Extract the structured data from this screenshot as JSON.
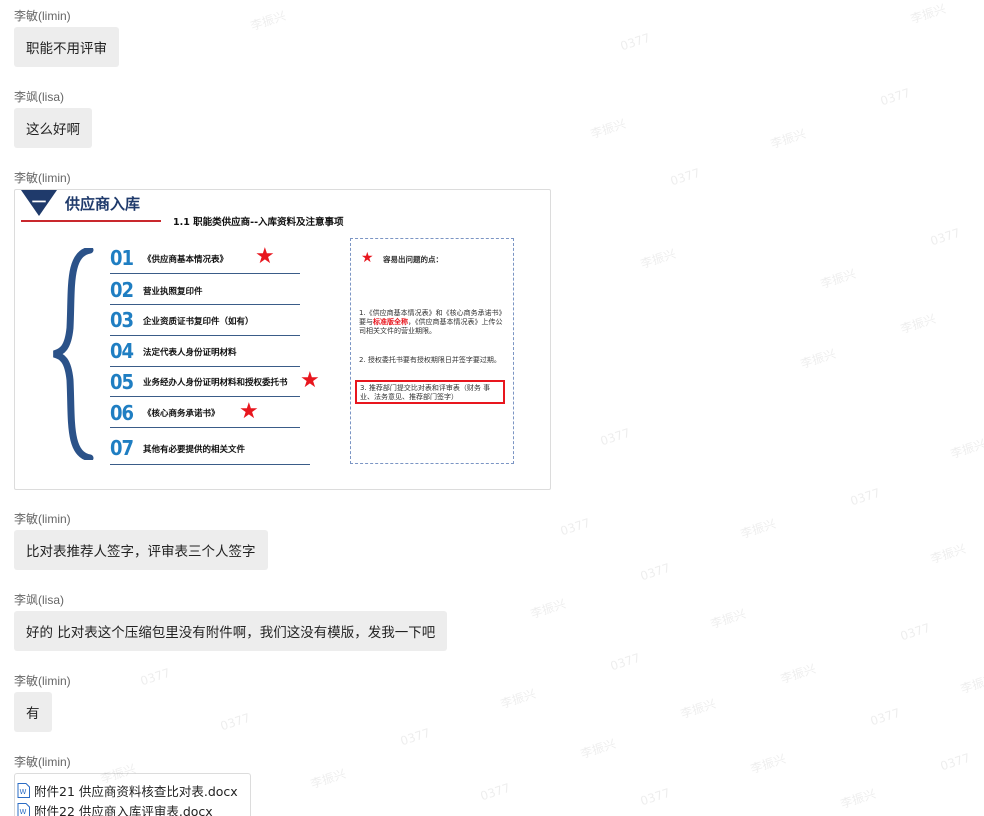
{
  "messages": [
    {
      "sender": "李敏(limin)",
      "text": "职能不用评审"
    },
    {
      "sender": "李飒(lisa)",
      "text": "这么好啊"
    },
    {
      "sender": "李敏(limin)",
      "type": "image"
    },
    {
      "sender": "李敏(limin)",
      "text": "比对表推荐人签字，评审表三个人签字"
    },
    {
      "sender": "李飒(lisa)",
      "text": "好的  比对表这个压缩包里没有附件啊，我们这没有模版，发我一下吧"
    },
    {
      "sender": "李敏(limin)",
      "text": "有"
    },
    {
      "sender": "李敏(limin)",
      "type": "files"
    }
  ],
  "slide": {
    "section_number": "一",
    "section_title": "供应商入库",
    "subtitle": "1.1 职能类供应商--入库资料及注意事项",
    "items": [
      {
        "num": "01",
        "label": "《供应商基本情况表》",
        "star": true
      },
      {
        "num": "02",
        "label": "营业执照复印件",
        "star": false
      },
      {
        "num": "03",
        "label": "企业资质证书复印件（如有）",
        "star": false
      },
      {
        "num": "04",
        "label": "法定代表人身份证明材料",
        "star": false
      },
      {
        "num": "05",
        "label": "业务经办人身份证明材料和授权委托书",
        "star": true
      },
      {
        "num": "06",
        "label": "《核心商务承诺书》",
        "star": true
      },
      {
        "num": "07",
        "label": "其他有必要提供的相关文件",
        "star": false
      }
    ],
    "notes_title": "容易出问题的点：",
    "note1_pre": "1.《供应商基本情况表》和《核心商务承诺书》要与",
    "note1_highlight": "标准版全称",
    "note1_post": "，《供应商基本情况表》上传公司相关文件的营业期限。",
    "note2": "2. 授权委托书要有授权期限日并签字要过期。",
    "note3": "3. 推荐部门提交比对表和评审表（财务 事业、法务意见、推荐部门签字）",
    "colors": {
      "accent": "#1f7ec2",
      "navy": "#1f3a6b",
      "red": "#e8161e"
    }
  },
  "files": [
    {
      "icon": "word-doc-icon",
      "name": "附件21 供应商资料核查比对表.docx"
    },
    {
      "icon": "word-doc-icon",
      "name": "附件22 供应商入库评审表.docx"
    }
  ],
  "watermarks": {
    "name": "李振兴",
    "code": "0377"
  }
}
